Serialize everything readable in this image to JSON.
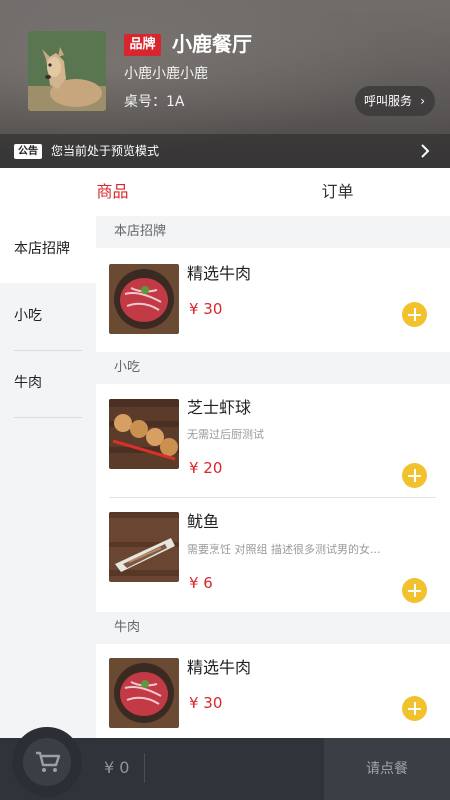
{
  "header": {
    "brand_tag": "品牌",
    "shop_name": "小鹿餐厅",
    "subtitle": "小鹿小鹿小鹿",
    "table_label": "桌号：1A",
    "call_service": "呼叫服务",
    "notice_tag": "公告",
    "notice_text": "您当前处于预览模式"
  },
  "tabs": {
    "goods": "商品",
    "orders": "订单"
  },
  "categories": [
    {
      "label": "本店招牌"
    },
    {
      "label": "小吃"
    },
    {
      "label": "牛肉"
    }
  ],
  "sections": [
    {
      "title": "本店招牌",
      "items": [
        {
          "name": "精选牛肉",
          "desc": "",
          "price": "¥ 30",
          "image": "beef-icon"
        }
      ]
    },
    {
      "title": "小吃",
      "items": [
        {
          "name": "芝士虾球",
          "desc": "无需过后厨测试",
          "price": "¥ 20",
          "image": "shrimp-ball-icon"
        },
        {
          "name": "鱿鱼",
          "desc": "需要烹饪 对照组 描述很多测试男的女...",
          "price": "¥ 6",
          "image": "squid-icon"
        }
      ]
    },
    {
      "title": "牛肉",
      "items": [
        {
          "name": "精选牛肉",
          "desc": "",
          "price": "¥ 30",
          "image": "beef-icon"
        }
      ]
    }
  ],
  "cart": {
    "total": "¥ 0",
    "checkout": "请点餐"
  },
  "colors": {
    "accent": "#d7262d",
    "add_button": "#f2c12e",
    "bottom_bar": "#2f343a"
  }
}
